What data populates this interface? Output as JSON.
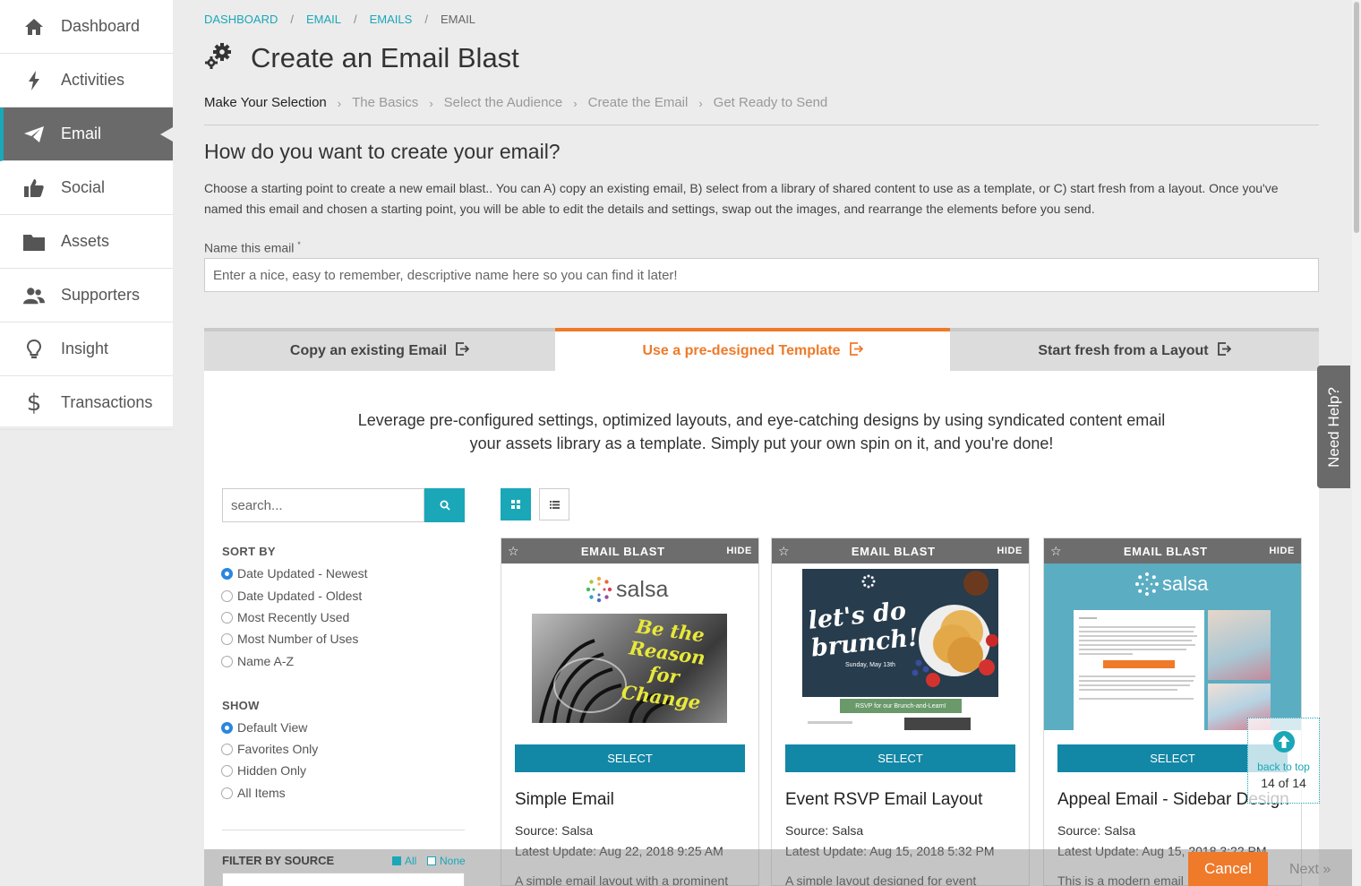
{
  "sidebar": {
    "items": [
      {
        "label": "Dashboard",
        "icon": "home-icon"
      },
      {
        "label": "Activities",
        "icon": "bolt-icon"
      },
      {
        "label": "Email",
        "icon": "paper-plane-icon"
      },
      {
        "label": "Social",
        "icon": "thumbs-up-icon"
      },
      {
        "label": "Assets",
        "icon": "folder-icon"
      },
      {
        "label": "Supporters",
        "icon": "users-icon"
      },
      {
        "label": "Insight",
        "icon": "lightbulb-icon"
      },
      {
        "label": "Transactions",
        "icon": "dollar-icon"
      }
    ],
    "active": "Email"
  },
  "breadcrumb": [
    "DASHBOARD",
    "EMAIL",
    "EMAILS",
    "EMAIL"
  ],
  "page": {
    "title": "Create an Email Blast",
    "steps": [
      "Make Your Selection",
      "The Basics",
      "Select the Audience",
      "Create the Email",
      "Get Ready to Send"
    ],
    "question": "How do you want to create your email?",
    "description": "Choose a starting point to create a new email blast.. You can A) copy an existing email, B) select from a library of shared content to use as a template, or C) start fresh from a layout. Once you've named this email and chosen a starting point, you will be able to edit the details and settings, swap out the images, and rearrange the elements before you send.",
    "name_label": "Name this email",
    "name_required_mark": "*",
    "name_placeholder": "Enter a nice, easy to remember, descriptive name here so you can find it later!"
  },
  "tabs": [
    {
      "label": "Copy an existing Email"
    },
    {
      "label": "Use a pre-designed Template"
    },
    {
      "label": "Start fresh from a Layout"
    }
  ],
  "panel": {
    "lead_line1": "Leverage pre-configured settings, optimized layouts, and eye-catching designs by using syndicated content email",
    "lead_line2": "your assets library as a template. Simply put your own spin on it, and you're done!",
    "search_placeholder": "search...",
    "sort_title": "SORT BY",
    "sort_options": [
      "Date Updated - Newest",
      "Date Updated - Oldest",
      "Most Recently Used",
      "Most Number of Uses",
      "Name A-Z"
    ],
    "show_title": "SHOW",
    "show_options": [
      "Default View",
      "Favorites Only",
      "Hidden Only",
      "All Items"
    ],
    "filter_title": "FILTER BY SOURCE",
    "filter_all": "All",
    "filter_none": "None"
  },
  "cards": [
    {
      "type": "EMAIL BLAST",
      "hide": "HIDE",
      "select": "SELECT",
      "name": "Simple Email",
      "source": "Source: Salsa",
      "updated": "Latest Update: Aug 22, 2018 9:25 AM",
      "desc": "A simple email layout with a prominent",
      "logo": "salsa",
      "overlay": "Be the Reason for Change"
    },
    {
      "type": "EMAIL BLAST",
      "hide": "HIDE",
      "select": "SELECT",
      "name": "Event RSVP Email Layout",
      "source": "Source: Salsa",
      "updated": "Latest Update: Aug 15, 2018 5:32 PM",
      "desc": "A simple layout designed for event",
      "overlay": "let's do brunch!",
      "overlay_sub": "Sunday, May 13th",
      "rsvp": "RSVP for our Brunch-and-Learn!"
    },
    {
      "type": "EMAIL BLAST",
      "hide": "HIDE",
      "select": "SELECT",
      "name": "Appeal Email - Sidebar Design",
      "source": "Source: Salsa",
      "updated": "Latest Update: Aug 15, 2018 3:22 PM",
      "desc": "This is a modern email",
      "logo": "salsa"
    }
  ],
  "footer": {
    "cancel": "Cancel",
    "next": "Next »"
  },
  "help": {
    "label": "Need Help?"
  },
  "back_to_top": {
    "label": "back to top",
    "count": "14 of 14"
  },
  "colors": {
    "accent": "#1aa7b8",
    "orange": "#ef7a2a",
    "select_btn": "#1387a6",
    "card_head": "#6d6d6d"
  }
}
